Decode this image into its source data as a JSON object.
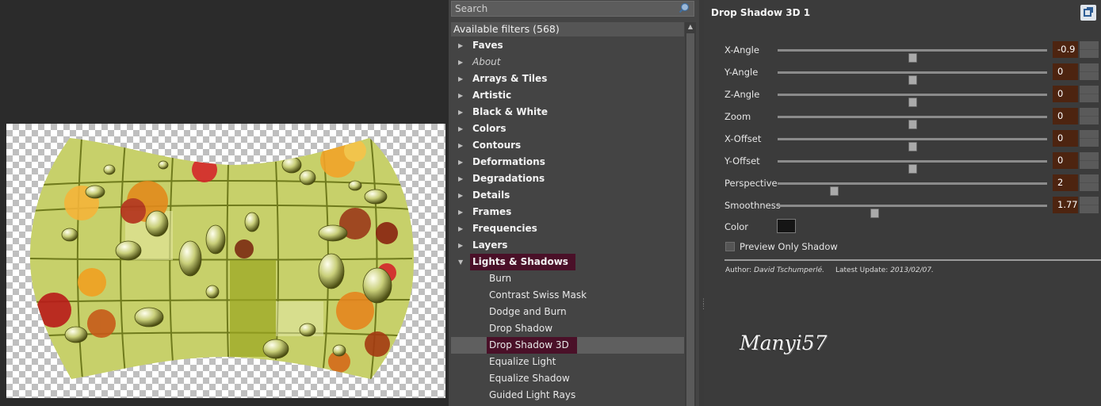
{
  "filter_list": {
    "search_placeholder": "Search",
    "header": "Available filters (568)",
    "categories": [
      {
        "label": "Faves"
      },
      {
        "label": "About"
      },
      {
        "label": "Arrays & Tiles"
      },
      {
        "label": "Artistic"
      },
      {
        "label": "Black & White"
      },
      {
        "label": "Colors"
      },
      {
        "label": "Contours"
      },
      {
        "label": "Deformations"
      },
      {
        "label": "Degradations"
      },
      {
        "label": "Details"
      },
      {
        "label": "Frames"
      },
      {
        "label": "Frequencies"
      },
      {
        "label": "Layers"
      },
      {
        "label": "Lights & Shadows"
      }
    ],
    "subitems": [
      {
        "label": "Burn"
      },
      {
        "label": "Contrast Swiss Mask"
      },
      {
        "label": "Dodge and Burn"
      },
      {
        "label": "Drop Shadow"
      },
      {
        "label": "Drop Shadow 3D"
      },
      {
        "label": "Equalize Light"
      },
      {
        "label": "Equalize Shadow"
      },
      {
        "label": "Guided Light Rays"
      }
    ],
    "expanded_category": "Lights & Shadows",
    "selected_filter": "Drop Shadow 3D"
  },
  "params": {
    "title": "Drop Shadow 3D 1",
    "sliders": [
      {
        "label": "X-Angle",
        "value": "-0.9",
        "fraction": 0.5
      },
      {
        "label": "Y-Angle",
        "value": "0",
        "fraction": 0.5
      },
      {
        "label": "Z-Angle",
        "value": "0",
        "fraction": 0.5
      },
      {
        "label": "Zoom",
        "value": "0",
        "fraction": 0.5
      },
      {
        "label": "X-Offset",
        "value": "0",
        "fraction": 0.5
      },
      {
        "label": "Y-Offset",
        "value": "0",
        "fraction": 0.5
      },
      {
        "label": "Perspective",
        "value": "2",
        "fraction": 0.21
      },
      {
        "label": "Smoothness",
        "value": "1.77",
        "fraction": 0.36
      }
    ],
    "color_label": "Color",
    "color_value": "#151515",
    "preview_only_label": "Preview Only Shadow",
    "preview_only_checked": false,
    "author_label": "Author:",
    "author_name": "David Tschumperlé.",
    "update_label": "Latest Update:",
    "update_date": "2013/02/07."
  },
  "signature": "Manyi57",
  "colors": {
    "panel_bg": "#444444",
    "selected_highlight": "#4a1028",
    "value_box": "#4d2410"
  }
}
